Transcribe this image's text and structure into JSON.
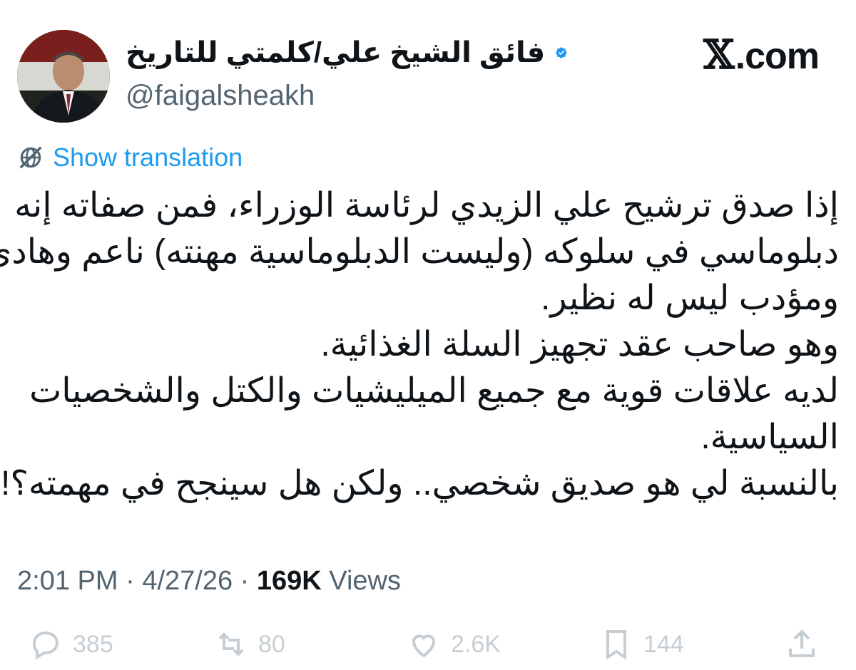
{
  "brand": {
    "label": ".com",
    "logo_icon": "x-logo-icon"
  },
  "author": {
    "display_name": "فائق الشيخ علي/كلمتي للتاريخ",
    "handle": "@faigalsheakh",
    "verified": true,
    "verified_color": "#1d9bf0"
  },
  "translate": {
    "label": "Show translation",
    "icon": "globe-slash-icon"
  },
  "tweet": {
    "lines": [
      "إذا صدق ترشيح علي الزيدي لرئاسة الوزراء، فمن صفاته إنه",
      "دبلوماسي في سلوكه (وليست الدبلوماسية مهنته) ناعم وهادئ",
      "ومؤدب ليس له نظير.",
      "وهو صاحب عقد تجهيز السلة الغذائية.",
      "لديه علاقات قوية مع جميع الميليشيات والكتل والشخصيات",
      "السياسية.",
      "بالنسبة لي هو صديق شخصي.. ولكن هل سينجح في مهمته؟!"
    ]
  },
  "meta": {
    "time": "2:01 PM",
    "separator": "·",
    "date": "4/27/26",
    "views_count": "169K",
    "views_label": "Views"
  },
  "actions": {
    "reply": {
      "count": "385",
      "icon": "reply-icon"
    },
    "repost": {
      "count": "80",
      "icon": "repost-icon"
    },
    "like": {
      "count": "2.6K",
      "icon": "heart-icon"
    },
    "bookmark": {
      "count": "144",
      "icon": "bookmark-icon"
    },
    "share": {
      "icon": "share-icon"
    }
  },
  "colors": {
    "link": "#1d9bf0",
    "muted": "#536471",
    "text": "#0f1419"
  }
}
